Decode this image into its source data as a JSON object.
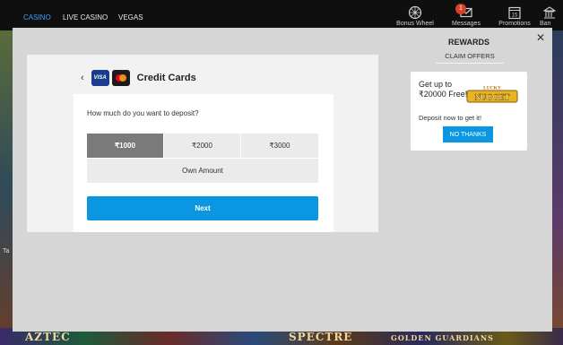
{
  "topnav": {
    "tabs": [
      "CASINO",
      "LIVE CASINO",
      "VEGAS"
    ],
    "icons": {
      "bonus_wheel": "Bonus Wheel",
      "messages": "Messages",
      "messages_badge": "1",
      "promotions": "Promotions",
      "promotions_day": "15",
      "banking": "Ban"
    }
  },
  "background": {
    "side_text": "Ta",
    "games": [
      "AZTEC",
      "SPECTRE",
      "GOLDEN GUARDIANS"
    ]
  },
  "deposit": {
    "title": "Credit Cards",
    "visa_label": "VISA",
    "question": "How much do you want to deposit?",
    "amounts": [
      "₹1000",
      "₹2000",
      "₹3000"
    ],
    "selected_amount": "₹1000",
    "own_amount": "Own Amount",
    "next": "Next"
  },
  "rewards": {
    "title": "REWARDS",
    "claim_offers": "CLAIM OFFERS",
    "offer": {
      "headline": "Get up to ₹20000 Free!",
      "logo_text": "NUGGET",
      "logo_top": "LUCKY",
      "subtext": "Deposit now to get it!",
      "button": "NO THANKS"
    }
  },
  "close_symbol": "✕",
  "colors": {
    "accent": "#0a96e0",
    "selected": "#7a7a7a",
    "badge": "#d9412b"
  }
}
